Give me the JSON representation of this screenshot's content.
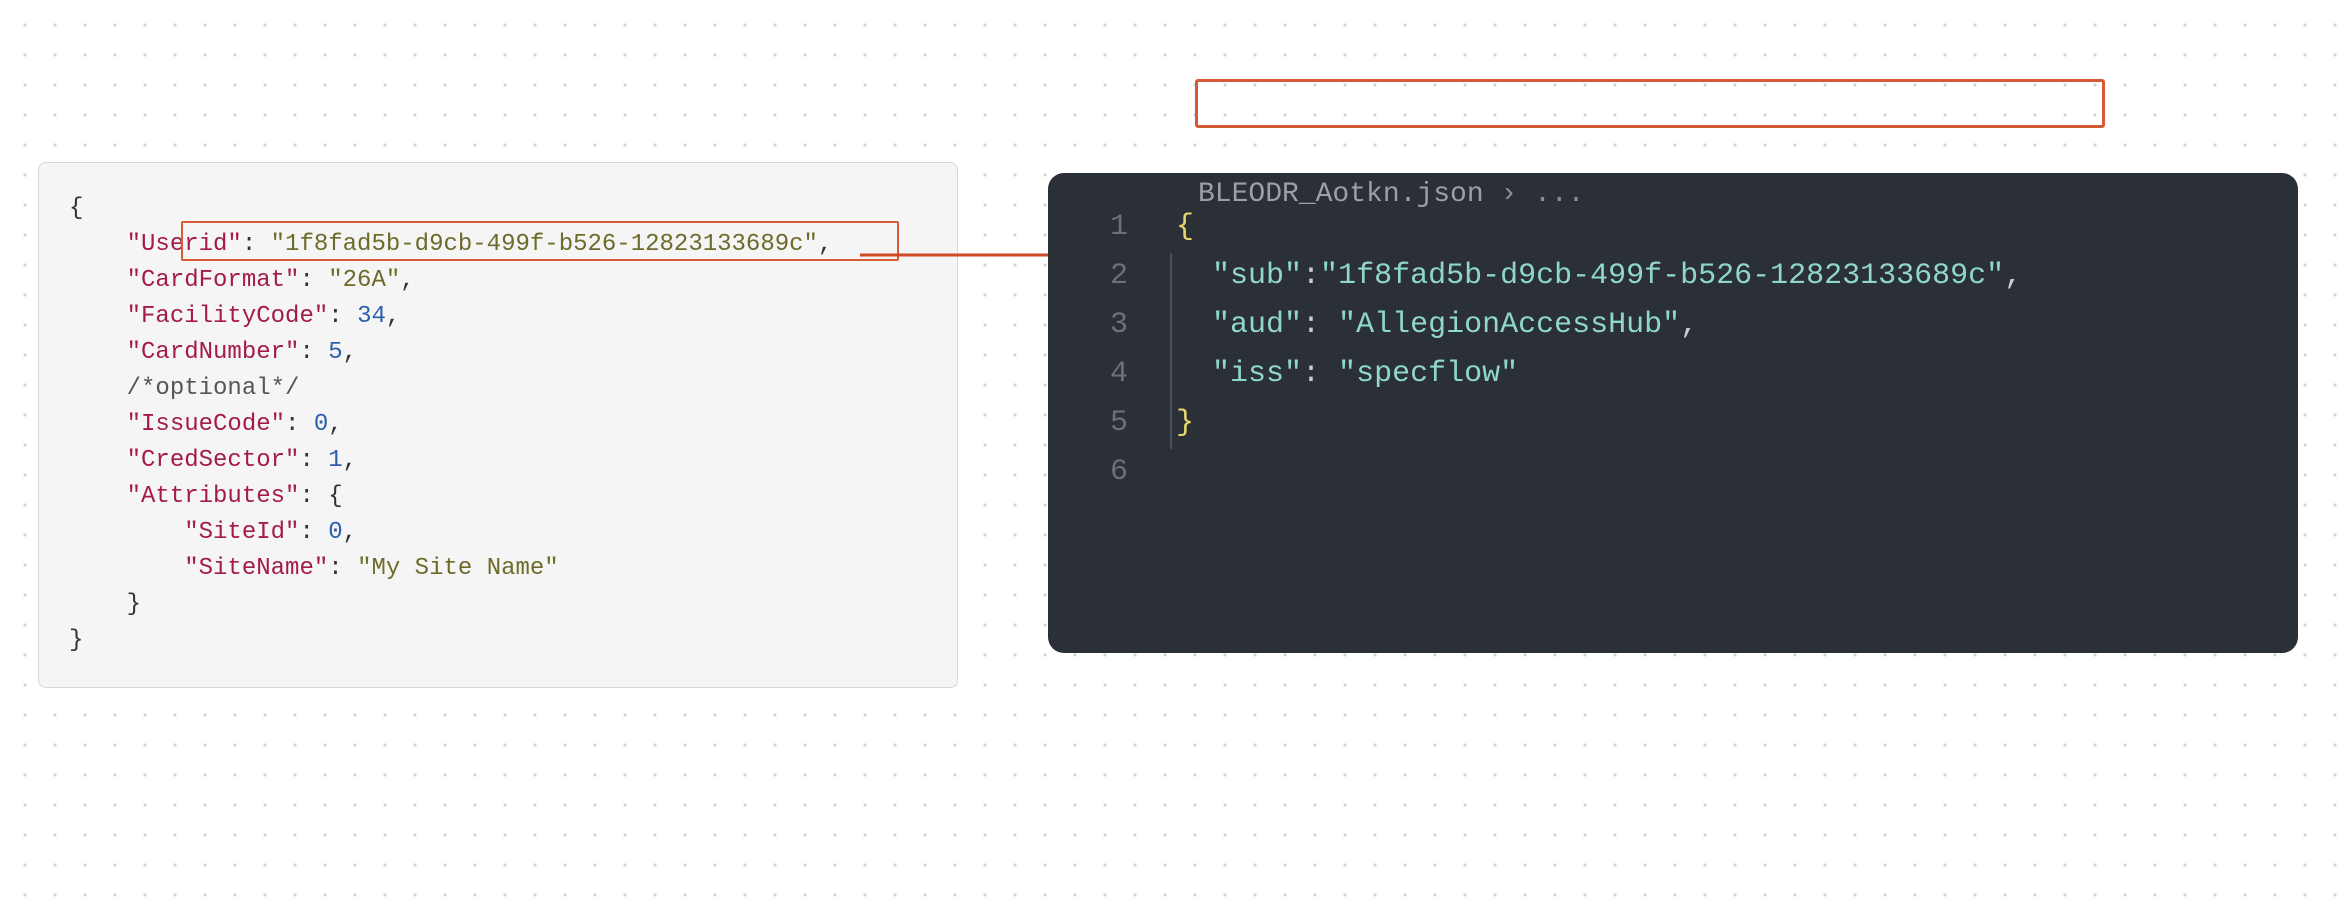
{
  "left": {
    "Userid": "1f8fad5b-d9cb-499f-b526-12823133689c",
    "CardFormat": "26A",
    "FacilityCode": 34,
    "CardNumber": 5,
    "optional_comment": "/*optional*/",
    "IssueCode": 0,
    "CredSector": 1,
    "Attributes": {
      "SiteId": 0,
      "SiteName": "My Site Name"
    }
  },
  "right": {
    "breadcrumb_frag": "BLEODR_Aotkn.json",
    "lines": [
      "1",
      "2",
      "3",
      "4",
      "5",
      "6"
    ],
    "sub": "1f8fad5b-d9cb-499f-b526-12823133689c",
    "aud": "AllegionAccessHub",
    "iss": "specflow"
  }
}
